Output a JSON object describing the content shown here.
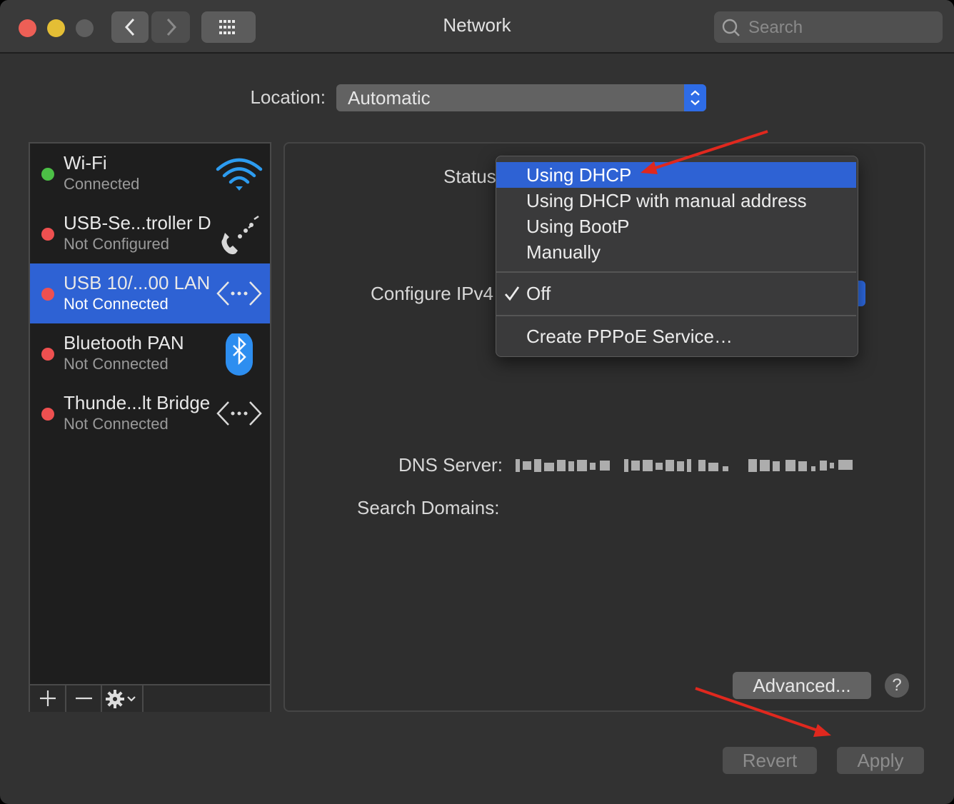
{
  "window": {
    "title": "Network",
    "traffic_lights": {
      "close": "#ed5f56",
      "minimize": "#e4be35",
      "zoom": "#5e5e5e"
    },
    "nav": {
      "back_icon": "chevron-left-icon",
      "forward_icon": "chevron-right-icon",
      "grid_icon": "grid-icon"
    },
    "search": {
      "placeholder": "Search"
    }
  },
  "location": {
    "label": "Location:",
    "value": "Automatic"
  },
  "services": [
    {
      "name": "Wi-Fi",
      "status": "Connected",
      "status_color": "#4cc046",
      "icon": "wifi-icon",
      "selected": false
    },
    {
      "name": "USB-Se...troller D",
      "status": "Not Configured",
      "status_color": "#ee5050",
      "icon": "modem-phone-icon",
      "selected": false
    },
    {
      "name": "USB 10/...00 LAN",
      "status": "Not Connected",
      "status_color": "#ee5050",
      "icon": "ethernet-icon",
      "selected": true
    },
    {
      "name": "Bluetooth PAN",
      "status": "Not Connected",
      "status_color": "#ee5050",
      "icon": "bluetooth-icon",
      "selected": false
    },
    {
      "name": "Thunde...lt Bridge",
      "status": "Not Connected",
      "status_color": "#ee5050",
      "icon": "ethernet-icon",
      "selected": false
    }
  ],
  "sidebar_toolbar": {
    "add": "+",
    "remove": "−",
    "action_icon": "gear-icon"
  },
  "detail": {
    "status_label": "Status",
    "configure_label": "Configure IPv4",
    "dns_label": "DNS Server:",
    "search_domains_label": "Search Domains:"
  },
  "configure_menu": {
    "items": [
      "Using DHCP",
      "Using DHCP with manual address",
      "Using BootP",
      "Manually"
    ],
    "highlighted": "Using DHCP",
    "checked": "Off",
    "action": "Create PPPoE Service…"
  },
  "buttons": {
    "advanced": "Advanced...",
    "help": "?",
    "revert": "Revert",
    "apply": "Apply"
  },
  "accent_color": "#2e62d4"
}
